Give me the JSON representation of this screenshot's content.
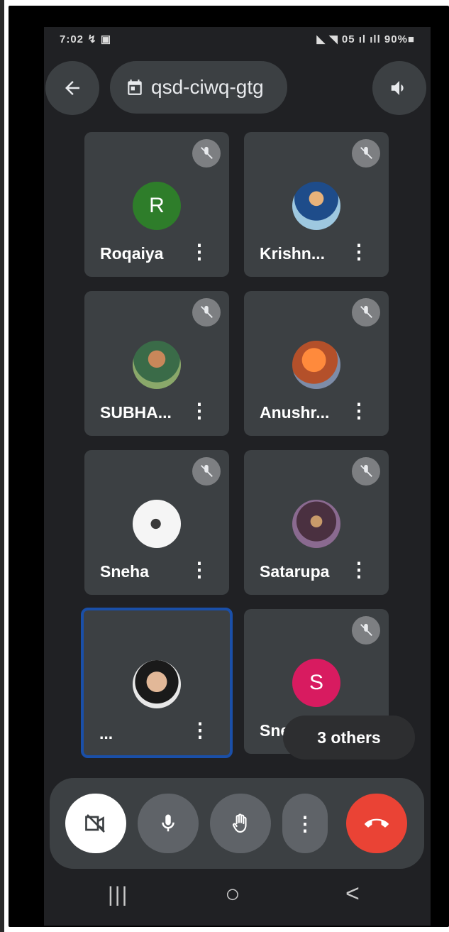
{
  "status_bar": {
    "time": "7:02 ↯ ▣",
    "right": "◣ ◥ 05 ıl ıll 90%■"
  },
  "header": {
    "meeting_code": "qsd-ciwq-gtg",
    "back_icon": "arrow-left-icon",
    "calendar_icon": "calendar-icon",
    "speaker_icon": "speaker-icon"
  },
  "participants": [
    {
      "name": "Roqaiya",
      "avatar_letter": "R",
      "avatar_color": "#2e7d2a",
      "muted": true
    },
    {
      "name": "Krishn...",
      "avatar_photo": true,
      "muted": true
    },
    {
      "name": "SUBHA...",
      "avatar_photo": true,
      "muted": true
    },
    {
      "name": "Anushr...",
      "avatar_photo": true,
      "muted": true
    },
    {
      "name": "Sneha",
      "avatar_photo": true,
      "muted": true
    },
    {
      "name": "Satarupa",
      "avatar_photo": true,
      "muted": true
    },
    {
      "name": "...",
      "avatar_photo": true,
      "muted": false,
      "active_speaker": true
    },
    {
      "name": "Sne",
      "avatar_letter": "S",
      "avatar_color": "#d81b60",
      "muted": true
    }
  ],
  "others_badge": "3 others",
  "controls": {
    "camera": "camera-off-icon",
    "mic": "mic-icon",
    "hand": "raise-hand-icon",
    "more": "more-vert-icon",
    "end": "end-call-icon",
    "end_color": "#ea4335"
  },
  "nav": {
    "recents": "|||",
    "home": "○",
    "back": "<"
  }
}
